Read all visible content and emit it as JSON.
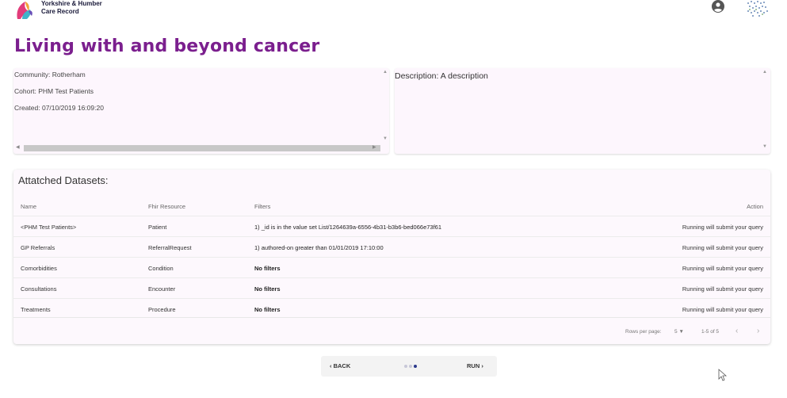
{
  "header": {
    "logo_line1": "Yorkshire & Humber",
    "logo_line2": "Care Record"
  },
  "page": {
    "title": "Living with and beyond cancer"
  },
  "info": {
    "community": "Community: Rotherham",
    "cohort": "Cohort: PHM Test Patients",
    "created": "Created: 07/10/2019 16:09:20"
  },
  "description": {
    "text": "Description: A description"
  },
  "datasets": {
    "title": "Attatched Datasets:",
    "columns": {
      "name": "Name",
      "resource": "Fhir Resource",
      "filters": "Filters",
      "action": "Action"
    },
    "rows": [
      {
        "name": "<PHM Test Patients>",
        "resource": "Patient",
        "filters": "1) _id is in the value set List/1264639a-6556-4b31-b3b6-bed066e73f61",
        "action": "Running will submit your query"
      },
      {
        "name": "GP Referrals",
        "resource": "ReferralRequest",
        "filters": "1) authored-on greater than 01/01/2019 17:10:00",
        "action": "Running will submit your query"
      },
      {
        "name": "Comorbidities",
        "resource": "Condition",
        "filters": "No filters",
        "action": "Running will submit your query"
      },
      {
        "name": "Consultations",
        "resource": "Encounter",
        "filters": "No filters",
        "action": "Running will submit your query"
      },
      {
        "name": "Treatments",
        "resource": "Procedure",
        "filters": "No filters",
        "action": "Running will submit your query"
      }
    ],
    "pagination": {
      "rows_per_page_label": "Rows per page:",
      "rows_per_page_value": "5",
      "range": "1-5 of 5"
    }
  },
  "stepper": {
    "back_label": "BACK",
    "run_label": "RUN",
    "steps_total": 3,
    "active_step": 3
  },
  "colors": {
    "title": "#7b1f8e",
    "panel_bg": "#fdf6fd",
    "active_dot": "#2c3a8c"
  }
}
